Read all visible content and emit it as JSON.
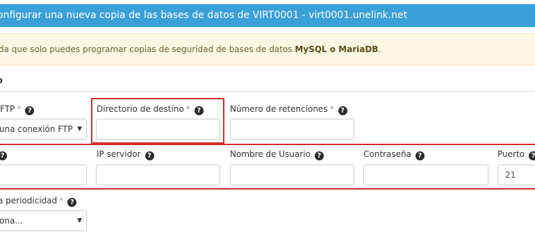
{
  "header": {
    "title": "onfigurar una nueva copia de las bases de datos de VIRT0001 - virt0001.unelink.net"
  },
  "alert": {
    "prefix": "da que solo puedes programar copias de seguridad de bases de datos ",
    "bold": "MySQL o MariaDB",
    "suffix": "."
  },
  "section": {
    "title": "o"
  },
  "row1": {
    "ftp_label": "FTP",
    "ftp_select_value": "una conexión FTP",
    "dest_label": "Directorio de destino",
    "dest_value": "",
    "retention_label": "Número de retenciones",
    "retention_value": ""
  },
  "row2": {
    "ip_label": "IP servidor",
    "user_label": "Nombre de Usuario",
    "password_label": "Contraseña",
    "port_label": "Puerto",
    "port_value": "21"
  },
  "row3": {
    "periodicity_label": "a periodicidad",
    "periodicity_value": "ona..."
  },
  "icons": {
    "help": "question-circle-icon",
    "caret": "chevron-down-icon"
  },
  "colors": {
    "header_bg": "#3aa0d8",
    "alert_bg": "#fcf8e3",
    "highlight": "#d12b2b"
  }
}
